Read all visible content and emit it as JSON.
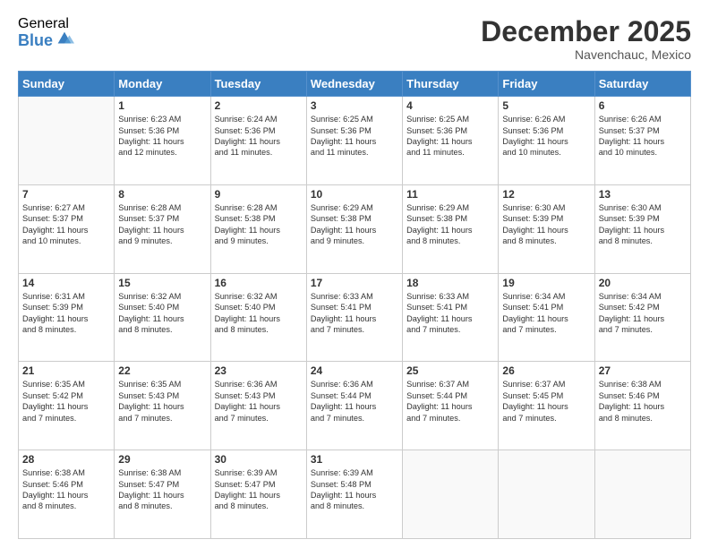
{
  "logo": {
    "general": "General",
    "blue": "Blue"
  },
  "header": {
    "month": "December 2025",
    "location": "Navenchauc, Mexico"
  },
  "weekdays": [
    "Sunday",
    "Monday",
    "Tuesday",
    "Wednesday",
    "Thursday",
    "Friday",
    "Saturday"
  ],
  "weeks": [
    [
      {
        "day": "",
        "info": ""
      },
      {
        "day": "1",
        "info": "Sunrise: 6:23 AM\nSunset: 5:36 PM\nDaylight: 11 hours\nand 12 minutes."
      },
      {
        "day": "2",
        "info": "Sunrise: 6:24 AM\nSunset: 5:36 PM\nDaylight: 11 hours\nand 11 minutes."
      },
      {
        "day": "3",
        "info": "Sunrise: 6:25 AM\nSunset: 5:36 PM\nDaylight: 11 hours\nand 11 minutes."
      },
      {
        "day": "4",
        "info": "Sunrise: 6:25 AM\nSunset: 5:36 PM\nDaylight: 11 hours\nand 11 minutes."
      },
      {
        "day": "5",
        "info": "Sunrise: 6:26 AM\nSunset: 5:36 PM\nDaylight: 11 hours\nand 10 minutes."
      },
      {
        "day": "6",
        "info": "Sunrise: 6:26 AM\nSunset: 5:37 PM\nDaylight: 11 hours\nand 10 minutes."
      }
    ],
    [
      {
        "day": "7",
        "info": "Sunrise: 6:27 AM\nSunset: 5:37 PM\nDaylight: 11 hours\nand 10 minutes."
      },
      {
        "day": "8",
        "info": "Sunrise: 6:28 AM\nSunset: 5:37 PM\nDaylight: 11 hours\nand 9 minutes."
      },
      {
        "day": "9",
        "info": "Sunrise: 6:28 AM\nSunset: 5:38 PM\nDaylight: 11 hours\nand 9 minutes."
      },
      {
        "day": "10",
        "info": "Sunrise: 6:29 AM\nSunset: 5:38 PM\nDaylight: 11 hours\nand 9 minutes."
      },
      {
        "day": "11",
        "info": "Sunrise: 6:29 AM\nSunset: 5:38 PM\nDaylight: 11 hours\nand 8 minutes."
      },
      {
        "day": "12",
        "info": "Sunrise: 6:30 AM\nSunset: 5:39 PM\nDaylight: 11 hours\nand 8 minutes."
      },
      {
        "day": "13",
        "info": "Sunrise: 6:30 AM\nSunset: 5:39 PM\nDaylight: 11 hours\nand 8 minutes."
      }
    ],
    [
      {
        "day": "14",
        "info": "Sunrise: 6:31 AM\nSunset: 5:39 PM\nDaylight: 11 hours\nand 8 minutes."
      },
      {
        "day": "15",
        "info": "Sunrise: 6:32 AM\nSunset: 5:40 PM\nDaylight: 11 hours\nand 8 minutes."
      },
      {
        "day": "16",
        "info": "Sunrise: 6:32 AM\nSunset: 5:40 PM\nDaylight: 11 hours\nand 8 minutes."
      },
      {
        "day": "17",
        "info": "Sunrise: 6:33 AM\nSunset: 5:41 PM\nDaylight: 11 hours\nand 7 minutes."
      },
      {
        "day": "18",
        "info": "Sunrise: 6:33 AM\nSunset: 5:41 PM\nDaylight: 11 hours\nand 7 minutes."
      },
      {
        "day": "19",
        "info": "Sunrise: 6:34 AM\nSunset: 5:41 PM\nDaylight: 11 hours\nand 7 minutes."
      },
      {
        "day": "20",
        "info": "Sunrise: 6:34 AM\nSunset: 5:42 PM\nDaylight: 11 hours\nand 7 minutes."
      }
    ],
    [
      {
        "day": "21",
        "info": "Sunrise: 6:35 AM\nSunset: 5:42 PM\nDaylight: 11 hours\nand 7 minutes."
      },
      {
        "day": "22",
        "info": "Sunrise: 6:35 AM\nSunset: 5:43 PM\nDaylight: 11 hours\nand 7 minutes."
      },
      {
        "day": "23",
        "info": "Sunrise: 6:36 AM\nSunset: 5:43 PM\nDaylight: 11 hours\nand 7 minutes."
      },
      {
        "day": "24",
        "info": "Sunrise: 6:36 AM\nSunset: 5:44 PM\nDaylight: 11 hours\nand 7 minutes."
      },
      {
        "day": "25",
        "info": "Sunrise: 6:37 AM\nSunset: 5:44 PM\nDaylight: 11 hours\nand 7 minutes."
      },
      {
        "day": "26",
        "info": "Sunrise: 6:37 AM\nSunset: 5:45 PM\nDaylight: 11 hours\nand 7 minutes."
      },
      {
        "day": "27",
        "info": "Sunrise: 6:38 AM\nSunset: 5:46 PM\nDaylight: 11 hours\nand 8 minutes."
      }
    ],
    [
      {
        "day": "28",
        "info": "Sunrise: 6:38 AM\nSunset: 5:46 PM\nDaylight: 11 hours\nand 8 minutes."
      },
      {
        "day": "29",
        "info": "Sunrise: 6:38 AM\nSunset: 5:47 PM\nDaylight: 11 hours\nand 8 minutes."
      },
      {
        "day": "30",
        "info": "Sunrise: 6:39 AM\nSunset: 5:47 PM\nDaylight: 11 hours\nand 8 minutes."
      },
      {
        "day": "31",
        "info": "Sunrise: 6:39 AM\nSunset: 5:48 PM\nDaylight: 11 hours\nand 8 minutes."
      },
      {
        "day": "",
        "info": ""
      },
      {
        "day": "",
        "info": ""
      },
      {
        "day": "",
        "info": ""
      }
    ]
  ]
}
